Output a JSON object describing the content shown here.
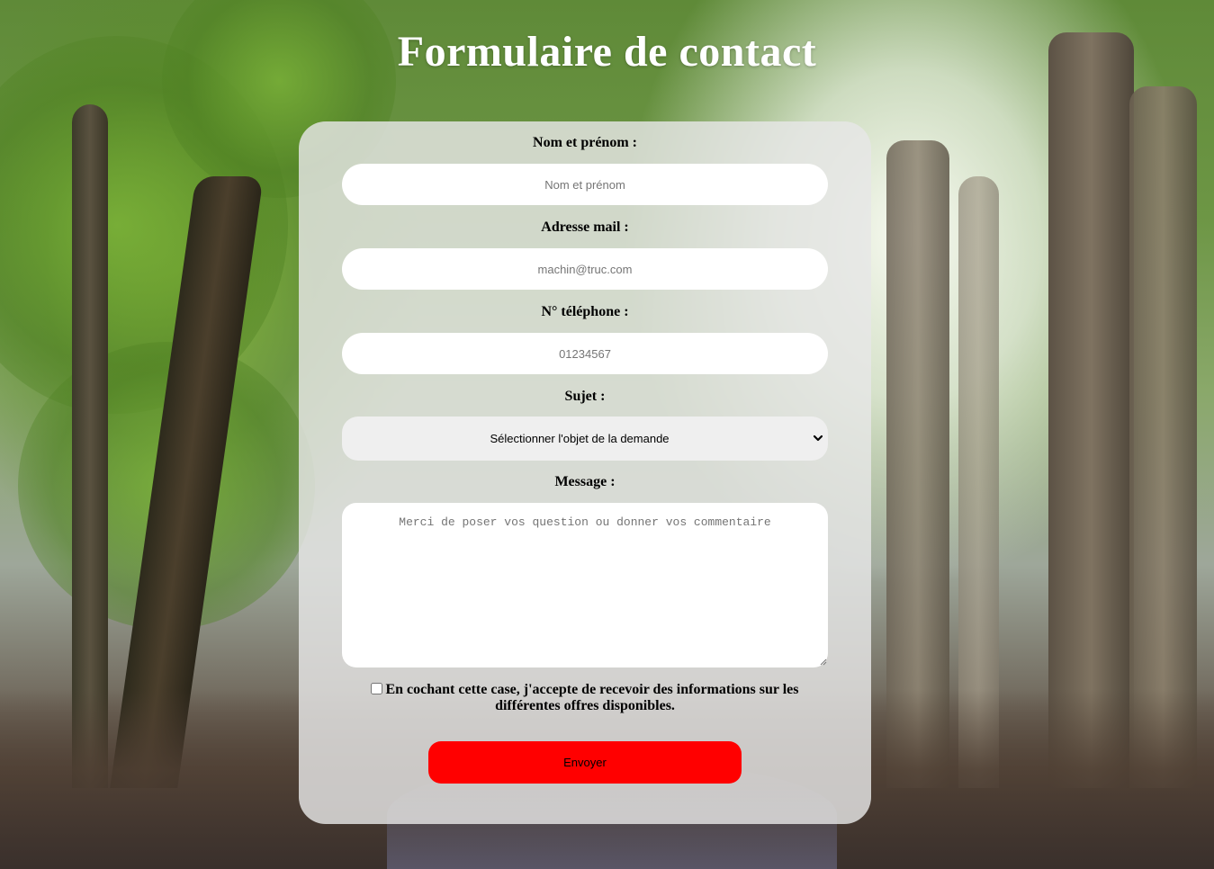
{
  "page": {
    "title": "Formulaire de contact"
  },
  "form": {
    "name": {
      "label": "Nom et prénom :",
      "placeholder": "Nom et prénom",
      "value": ""
    },
    "email": {
      "label": "Adresse mail :",
      "placeholder": "machin@truc.com",
      "value": ""
    },
    "phone": {
      "label": "N° téléphone :",
      "placeholder": "01234567",
      "value": ""
    },
    "subject": {
      "label": "Sujet :",
      "selected": "Sélectionner l'objet de la demande",
      "icon": "chevron-down-icon"
    },
    "message": {
      "label": "Message :",
      "placeholder": "Merci de poser vos question ou donner vos commentaire",
      "value": ""
    },
    "consent": {
      "checked": false,
      "text": "En cochant cette case, j'accepte de recevoir des informations sur les différentes offres disponibles."
    },
    "submit_label": "Envoyer"
  },
  "colors": {
    "submit_button": "#ff0000",
    "card_background": "rgba(230,230,230,0.82)",
    "title_text": "#ffffff"
  }
}
